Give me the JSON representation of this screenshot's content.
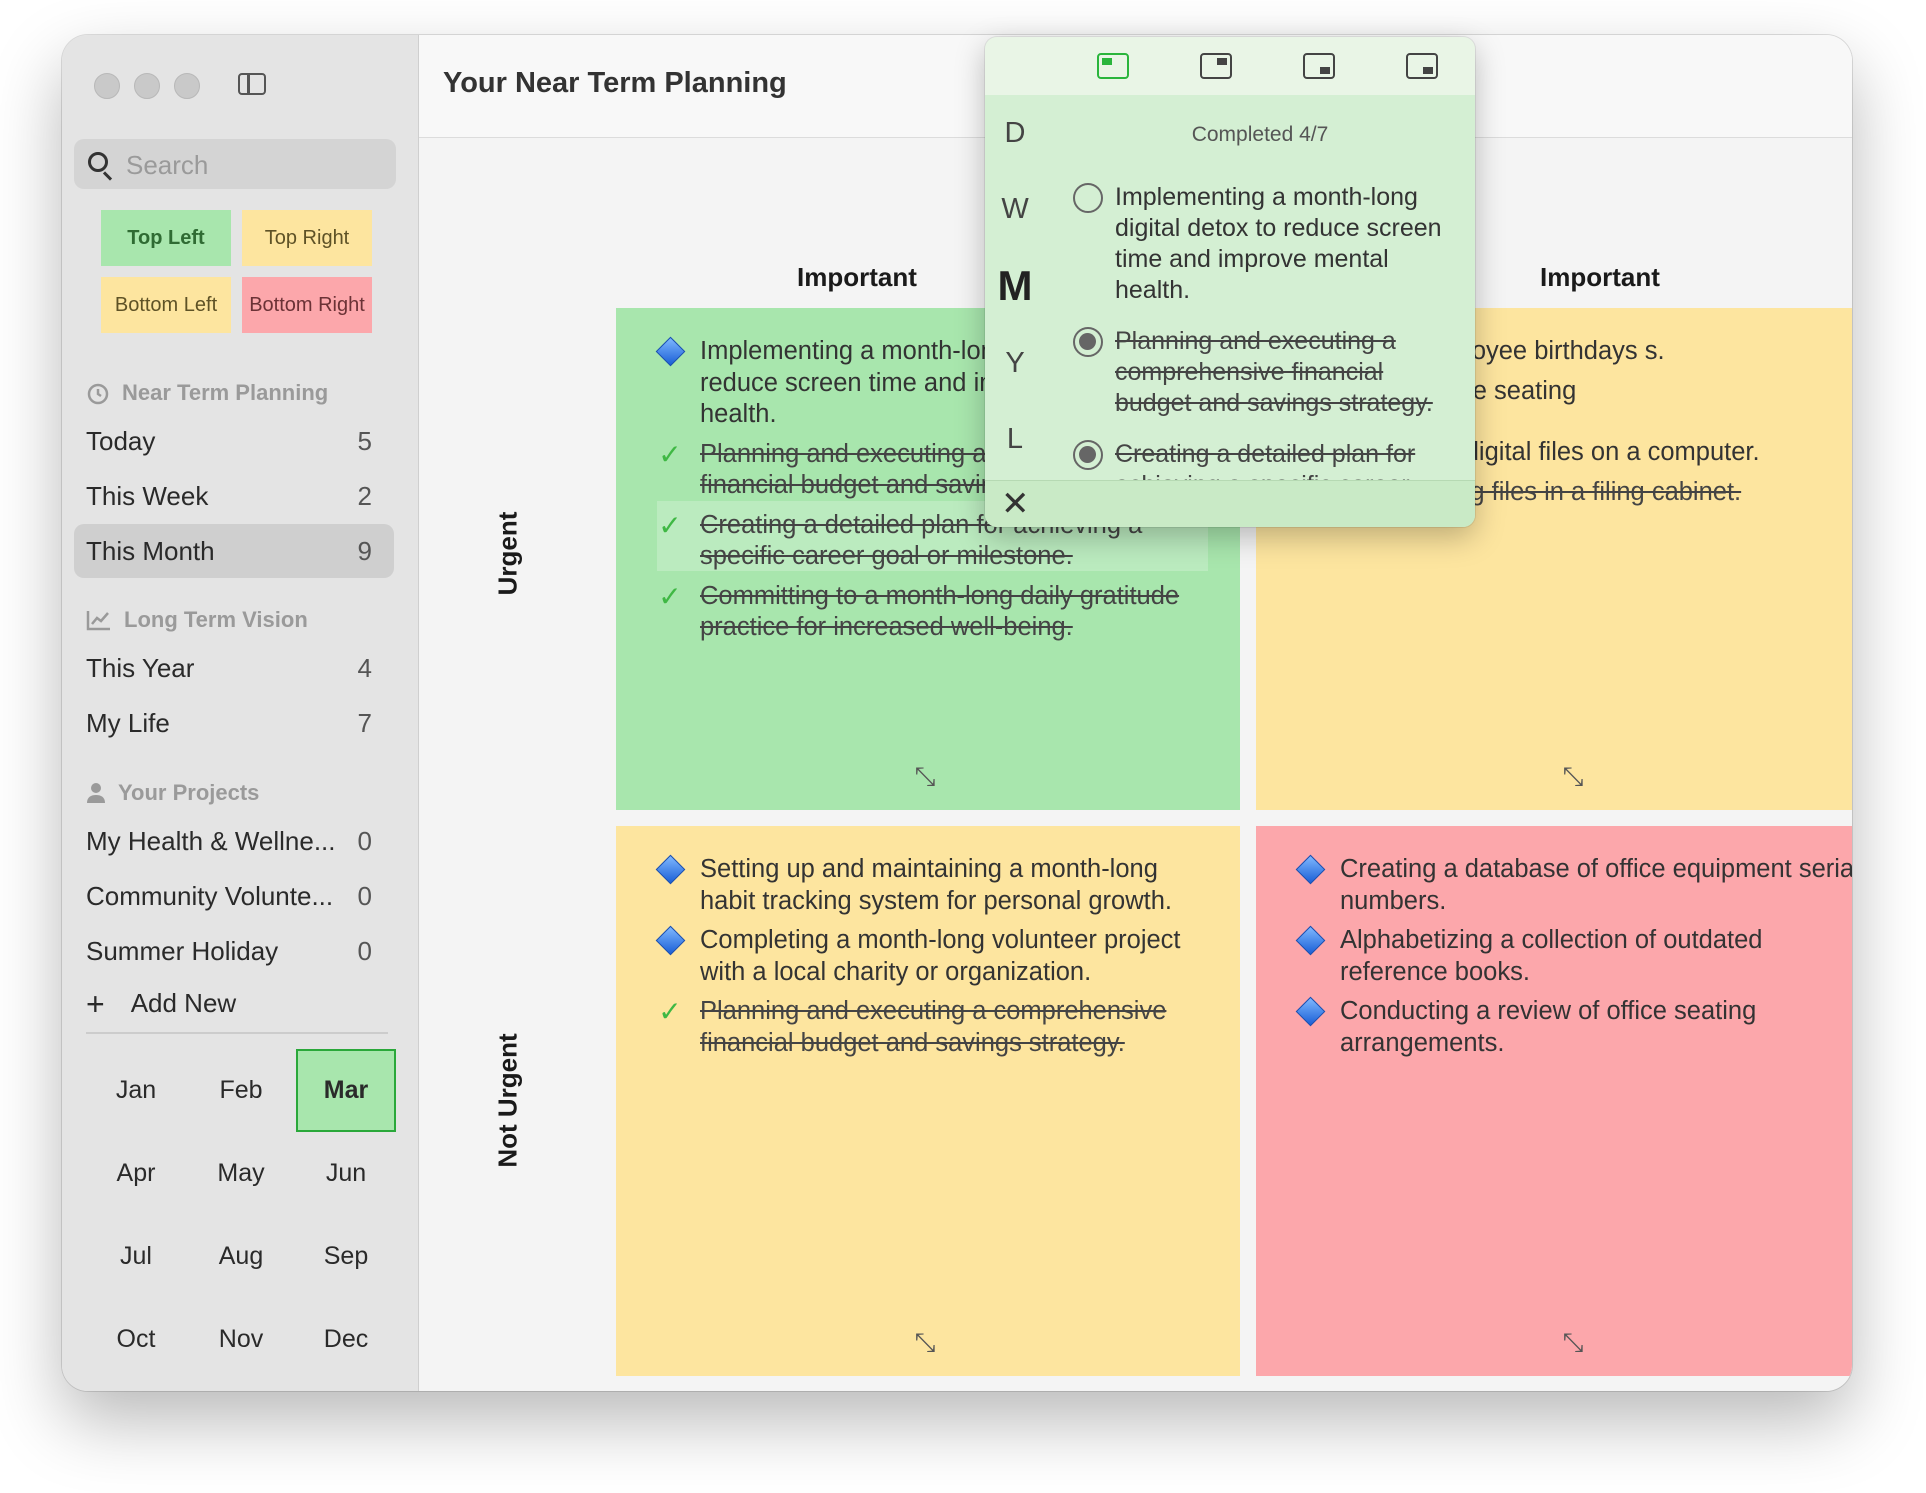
{
  "sidebar": {
    "search_placeholder": "Search",
    "quadrant_buttons": [
      {
        "label": "Top Left",
        "bg": "#a8e6ad",
        "color": "#2f6b33"
      },
      {
        "label": "Top Right",
        "bg": "#fde59f",
        "color": "#5e5226"
      },
      {
        "label": "Bottom Left",
        "bg": "#fde59f",
        "color": "#5e5226"
      },
      {
        "label": "Bottom Right",
        "bg": "#fca7ab",
        "color": "#6b3236"
      }
    ],
    "near_term": {
      "title": "Near Term Planning",
      "icon": "clock-icon",
      "items": [
        {
          "label": "Today",
          "count": "5"
        },
        {
          "label": "This Week",
          "count": "2"
        },
        {
          "label": "This Month",
          "count": "9"
        }
      ]
    },
    "long_term": {
      "title": "Long Term Vision",
      "icon": "chart-icon",
      "items": [
        {
          "label": "This Year",
          "count": "4"
        },
        {
          "label": "My Life",
          "count": "7"
        }
      ]
    },
    "projects": {
      "title": "Your Projects",
      "icon": "person-icon",
      "items": [
        {
          "label": "My Health & Wellne...",
          "count": "0"
        },
        {
          "label": "Community Volunte...",
          "count": "0"
        },
        {
          "label": "Summer Holiday",
          "count": "0"
        }
      ]
    },
    "add_new": "Add New",
    "months": [
      "Jan",
      "Feb",
      "Mar",
      "Apr",
      "May",
      "Jun",
      "Jul",
      "Aug",
      "Sep",
      "Oct",
      "Nov",
      "Dec"
    ],
    "selected_month": "Mar"
  },
  "main": {
    "title": "Your Near Term Planning",
    "col_important": "Important",
    "col_not_important": "Important",
    "row_urgent": "Urgent",
    "row_not_urgent": "Not Urgent"
  },
  "quadrants": {
    "top_left": {
      "bg": "#a8e6ad",
      "tasks": [
        {
          "text": "Implementing a month-long digital detox to reduce screen time and improve mental health.",
          "done": false
        },
        {
          "text": "Planning and executing a comprehensive financial budget and savings strategy.",
          "done": true
        },
        {
          "text": "Creating a detailed plan for achieving a specific career goal or milestone.",
          "done": true
        },
        {
          "text": "Committing to a month-long daily gratitude practice for increased well-being.",
          "done": true
        }
      ]
    },
    "top_right": {
      "bg": "#fde59f",
      "tasks": [
        {
          "text": "ase of employee birthdays s.",
          "done": false
        },
        {
          "text": "view of office seating",
          "done": false
        },
        {
          "text": "organizing digital files on a computer.",
          "done": false
        },
        {
          "text": "Color-coding files in a filing cabinet.",
          "done": true
        }
      ]
    },
    "bottom_left": {
      "bg": "#fde59f",
      "tasks": [
        {
          "text": "Setting up and maintaining a month-long habit tracking system for personal growth.",
          "done": false
        },
        {
          "text": "Completing a month-long volunteer project with a local charity or organization.",
          "done": false
        },
        {
          "text": "Planning and executing a comprehensive financial budget and savings strategy.",
          "done": true
        }
      ]
    },
    "bottom_right": {
      "bg": "#fca7ab",
      "tasks": [
        {
          "text": "Creating a database of office equipment serial numbers.",
          "done": false
        },
        {
          "text": "Alphabetizing a collection of outdated reference books.",
          "done": false
        },
        {
          "text": "Conducting a review of office seating arrangements.",
          "done": false
        }
      ]
    }
  },
  "popover": {
    "layout_icons": [
      "layout-top-left-icon",
      "layout-top-right-icon",
      "layout-bottom-right-icon",
      "layout-bottom-right-alt-icon"
    ],
    "periods": [
      "D",
      "W",
      "M",
      "Y",
      "L"
    ],
    "active_period": "M",
    "completed_label": "Completed 4/7",
    "tasks": [
      {
        "text": "Implementing a month-long digital detox to reduce screen time and improve mental health.",
        "done": false
      },
      {
        "text": "Planning and executing a comprehensive financial budget and savings strategy.",
        "done": true
      },
      {
        "text": "Creating a detailed plan for achieving a specific career goal or milestone.",
        "done": true
      }
    ]
  }
}
